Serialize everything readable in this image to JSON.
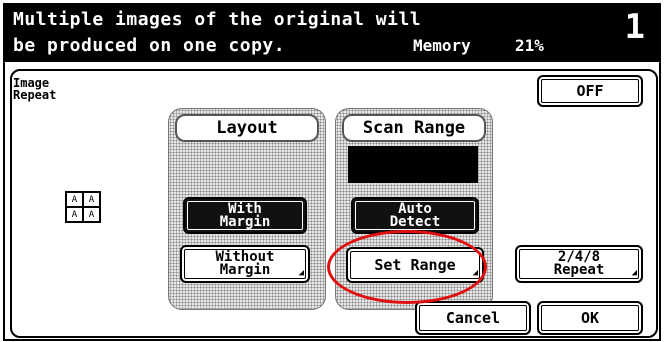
{
  "header": {
    "message_line1": "Multiple images of the original will",
    "message_line2": "be produced on one copy.",
    "memory_label": "Memory",
    "memory_value": "21%",
    "copy_count": "1"
  },
  "function_title": "Image\nRepeat",
  "off_button": "OFF",
  "layout": {
    "title": "Layout",
    "with_margin": "With\nMargin",
    "without_margin": "Without\nMargin"
  },
  "scan_range": {
    "title": "Scan Range",
    "auto_detect": "Auto\nDetect",
    "set_range": "Set Range"
  },
  "repeat_button": "2/4/8\nRepeat",
  "icon_glyph": "A",
  "cancel_button": "Cancel",
  "ok_button": "OK",
  "highlight_color": "#e01010"
}
